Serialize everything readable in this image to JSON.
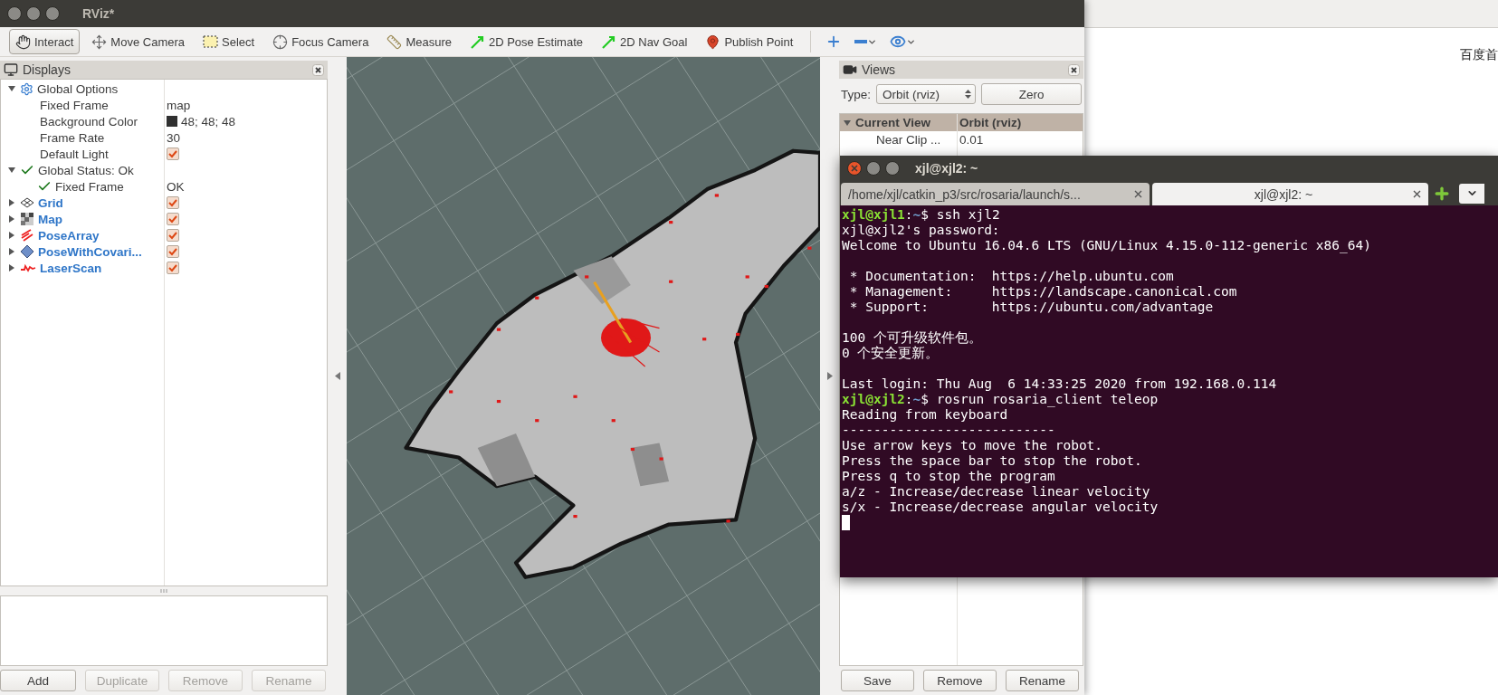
{
  "rviz": {
    "title": "RViz*",
    "tools": [
      {
        "label": "Interact",
        "kind": "interact",
        "selected": true
      },
      {
        "label": "Move Camera",
        "kind": "move",
        "selected": false
      },
      {
        "label": "Select",
        "kind": "select",
        "selected": false
      },
      {
        "label": "Focus Camera",
        "kind": "focus",
        "selected": false
      },
      {
        "label": "Measure",
        "kind": "measure",
        "selected": false
      },
      {
        "label": "2D Pose Estimate",
        "kind": "pose",
        "selected": false
      },
      {
        "label": "2D Nav Goal",
        "kind": "goal",
        "selected": false
      },
      {
        "label": "Publish Point",
        "kind": "point",
        "selected": false
      }
    ],
    "tool_icons": [
      {
        "kind": "add",
        "menu": false
      },
      {
        "kind": "remove",
        "menu": true
      },
      {
        "kind": "view",
        "menu": true
      }
    ],
    "displays": {
      "title": "Displays",
      "tree": [
        {
          "name": "Global Options",
          "kind": "options",
          "expanded": true,
          "children": [
            {
              "name": "Fixed Frame",
              "kind": "property",
              "value": "map"
            },
            {
              "name": "Background Color",
              "kind": "property",
              "value": "48; 48; 48",
              "color": "#303030"
            },
            {
              "name": "Frame Rate",
              "kind": "property",
              "value": "30"
            },
            {
              "name": "Default Light",
              "kind": "property",
              "checked": true
            }
          ]
        },
        {
          "name": "Global Status: Ok",
          "kind": "status",
          "expanded": true,
          "children": [
            {
              "name": "Fixed Frame",
              "kind": "status",
              "value": "OK"
            }
          ]
        },
        {
          "name": "Grid",
          "kind": "grid",
          "expanded": false,
          "checked": true
        },
        {
          "name": "Map",
          "kind": "map",
          "expanded": false,
          "checked": true
        },
        {
          "name": "PoseArray",
          "kind": "pose_array",
          "expanded": false,
          "checked": true
        },
        {
          "name": "PoseWithCovari...",
          "kind": "pose_covariance",
          "expanded": false,
          "checked": true
        },
        {
          "name": "LaserScan",
          "kind": "laser_scan",
          "expanded": false,
          "checked": true
        }
      ],
      "buttons": [
        {
          "label": "Add",
          "disabled": false
        },
        {
          "label": "Duplicate",
          "disabled": true
        },
        {
          "label": "Remove",
          "disabled": true
        },
        {
          "label": "Rename",
          "disabled": true
        }
      ]
    },
    "views": {
      "title": "Views",
      "type_label": "Type:",
      "type_value": "Orbit (rviz)",
      "zero_button": "Zero",
      "columns": [
        "Current View",
        "Orbit (rviz)"
      ],
      "rows": [
        {
          "name": "Near Clip ...",
          "value": "0.01"
        }
      ],
      "buttons": [
        "Save",
        "Remove",
        "Rename"
      ]
    }
  },
  "terminal": {
    "title": "xjl@xjl2: ~",
    "tabs": [
      {
        "label": "/home/xjl/catkin_p3/src/rosaria/launch/s...",
        "selected": false
      },
      {
        "label": "xjl@xjl2: ~",
        "selected": true
      }
    ],
    "lines": [
      {
        "kind": "prompt",
        "user": "xjl@xjl1",
        "sep": ":",
        "path": "~",
        "text": "$ ssh xjl2"
      },
      {
        "kind": "text",
        "text": "xjl@xjl2's password:"
      },
      {
        "kind": "text",
        "text": "Welcome to Ubuntu 16.04.6 LTS (GNU/Linux 4.15.0-112-generic x86_64)"
      },
      {
        "kind": "blank"
      },
      {
        "kind": "text",
        "text": " * Documentation:  https://help.ubuntu.com"
      },
      {
        "kind": "text",
        "text": " * Management:     https://landscape.canonical.com"
      },
      {
        "kind": "text",
        "text": " * Support:        https://ubuntu.com/advantage"
      },
      {
        "kind": "blank"
      },
      {
        "kind": "text",
        "text": "100 个可升级软件包。"
      },
      {
        "kind": "text",
        "text": "0 个安全更新。"
      },
      {
        "kind": "blank"
      },
      {
        "kind": "text",
        "text": "Last login: Thu Aug  6 14:33:25 2020 from 192.168.0.114"
      },
      {
        "kind": "prompt",
        "user": "xjl@xjl2",
        "sep": ":",
        "path": "~",
        "text": "$ rosrun rosaria_client teleop"
      },
      {
        "kind": "text",
        "text": "Reading from keyboard"
      },
      {
        "kind": "text",
        "text": "---------------------------"
      },
      {
        "kind": "text",
        "text": "Use arrow keys to move the robot."
      },
      {
        "kind": "text",
        "text": "Press the space bar to stop the robot."
      },
      {
        "kind": "text",
        "text": "Press q to stop the program"
      },
      {
        "kind": "text",
        "text": "a/z - Increase/decrease linear velocity"
      },
      {
        "kind": "text",
        "text": "s/x - Increase/decrease angular velocity"
      },
      {
        "kind": "cursor"
      }
    ]
  },
  "browser": {
    "link": "百度首"
  }
}
